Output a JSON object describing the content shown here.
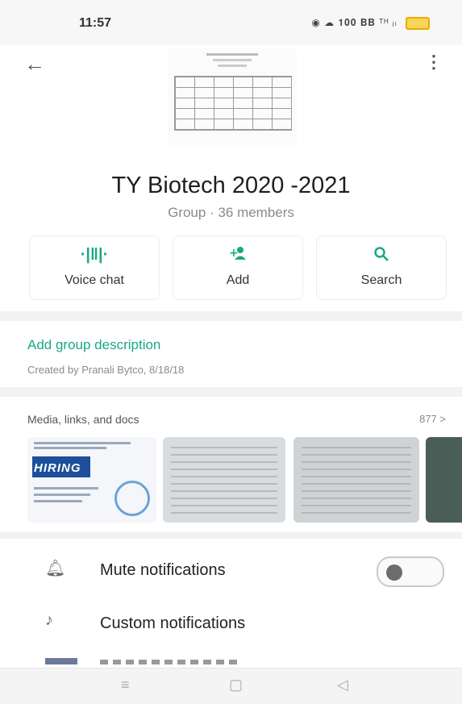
{
  "status_bar": {
    "time": "11:57",
    "icons_text": "◉ ☁ 𝟏𝟎𝟎 𝐁𝐁 ᵀᴴ ᵢₗ"
  },
  "header": {
    "back_icon": "back-arrow-icon",
    "menu_icon": "more-vert-icon",
    "group_name": "TY Biotech 2020 -2021",
    "group_meta": "Group · 36 members"
  },
  "actions": [
    {
      "label": "Voice chat",
      "icon": "voice-chat-icon",
      "glyph": "·|‖|·"
    },
    {
      "label": "Add",
      "icon": "add-person-icon",
      "glyph": "+👤"
    },
    {
      "label": "Search",
      "icon": "search-icon",
      "glyph": "🔍"
    }
  ],
  "description": {
    "add_link": "Add group description",
    "created": "Created by Pranali Bytco, 8/18/18"
  },
  "media": {
    "title": "Media, links, and docs",
    "count": "877 >",
    "hiring_text": "HIRING"
  },
  "settings": {
    "mute_label": "Mute notifications",
    "custom_label": "Custom notifications",
    "mute_icon": "bell-icon",
    "custom_icon": "music-note-icon",
    "mute_enabled": false
  },
  "colors": {
    "accent": "#1aa884",
    "background": "#f2f2f2"
  }
}
